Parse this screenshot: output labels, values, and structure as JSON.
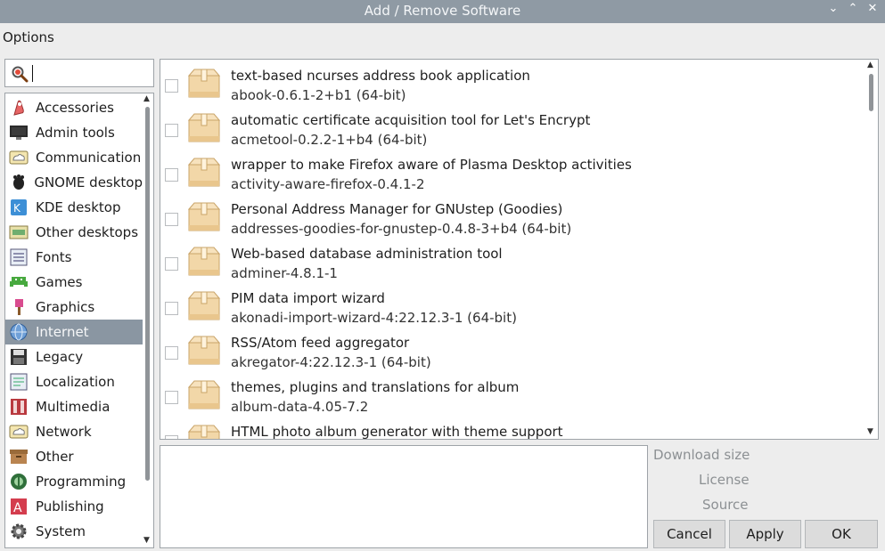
{
  "window": {
    "title": "Add / Remove Software",
    "controls": [
      "minimize",
      "maximize",
      "close"
    ]
  },
  "menubar": {
    "options": "Options"
  },
  "search": {
    "value": "",
    "placeholder": "",
    "icon": "search-icon"
  },
  "categories": [
    {
      "label": "Accessories",
      "icon": "accessories-icon"
    },
    {
      "label": "Admin tools",
      "icon": "admin-tools-icon"
    },
    {
      "label": "Communication",
      "icon": "communication-icon"
    },
    {
      "label": "GNOME desktop",
      "icon": "gnome-icon"
    },
    {
      "label": "KDE desktop",
      "icon": "kde-icon"
    },
    {
      "label": "Other desktops",
      "icon": "other-desktops-icon"
    },
    {
      "label": "Fonts",
      "icon": "fonts-icon"
    },
    {
      "label": "Games",
      "icon": "games-icon"
    },
    {
      "label": "Graphics",
      "icon": "graphics-icon"
    },
    {
      "label": "Internet",
      "icon": "globe-icon",
      "selected": true
    },
    {
      "label": "Legacy",
      "icon": "legacy-icon"
    },
    {
      "label": "Localization",
      "icon": "localization-icon"
    },
    {
      "label": "Multimedia",
      "icon": "multimedia-icon"
    },
    {
      "label": "Network",
      "icon": "network-icon"
    },
    {
      "label": "Other",
      "icon": "other-icon"
    },
    {
      "label": "Programming",
      "icon": "programming-icon"
    },
    {
      "label": "Publishing",
      "icon": "publishing-icon"
    },
    {
      "label": "System",
      "icon": "system-icon"
    }
  ],
  "packages": [
    {
      "description": "text-based ncurses address book application",
      "name": "abook-0.6.1-2+b1 (64-bit)",
      "checked": false
    },
    {
      "description": "automatic certificate acquisition tool for Let's Encrypt",
      "name": "acmetool-0.2.2-1+b4 (64-bit)",
      "checked": false
    },
    {
      "description": "wrapper to make Firefox aware of Plasma Desktop activities",
      "name": "activity-aware-firefox-0.4.1-2",
      "checked": false
    },
    {
      "description": "Personal Address Manager for GNUstep (Goodies)",
      "name": "addresses-goodies-for-gnustep-0.4.8-3+b4 (64-bit)",
      "checked": false
    },
    {
      "description": "Web-based database administration tool",
      "name": "adminer-4.8.1-1",
      "checked": false
    },
    {
      "description": "PIM data import wizard",
      "name": "akonadi-import-wizard-4:22.12.3-1 (64-bit)",
      "checked": false
    },
    {
      "description": "RSS/Atom feed aggregator",
      "name": "akregator-4:22.12.3-1 (64-bit)",
      "checked": false
    },
    {
      "description": "themes, plugins and translations for album",
      "name": "album-data-4.05-7.2",
      "checked": false
    },
    {
      "description": "HTML photo album generator with theme support",
      "name": "",
      "checked": false
    }
  ],
  "details": {
    "download_size": "Download size",
    "license": "License",
    "source": "Source"
  },
  "buttons": {
    "cancel": "Cancel",
    "apply": "Apply",
    "ok": "OK"
  },
  "colors": {
    "titlebar": "#8f9aa4",
    "selection": "#8a96a2",
    "window_bg": "#ededed",
    "package_box": "#f2d7a8"
  }
}
